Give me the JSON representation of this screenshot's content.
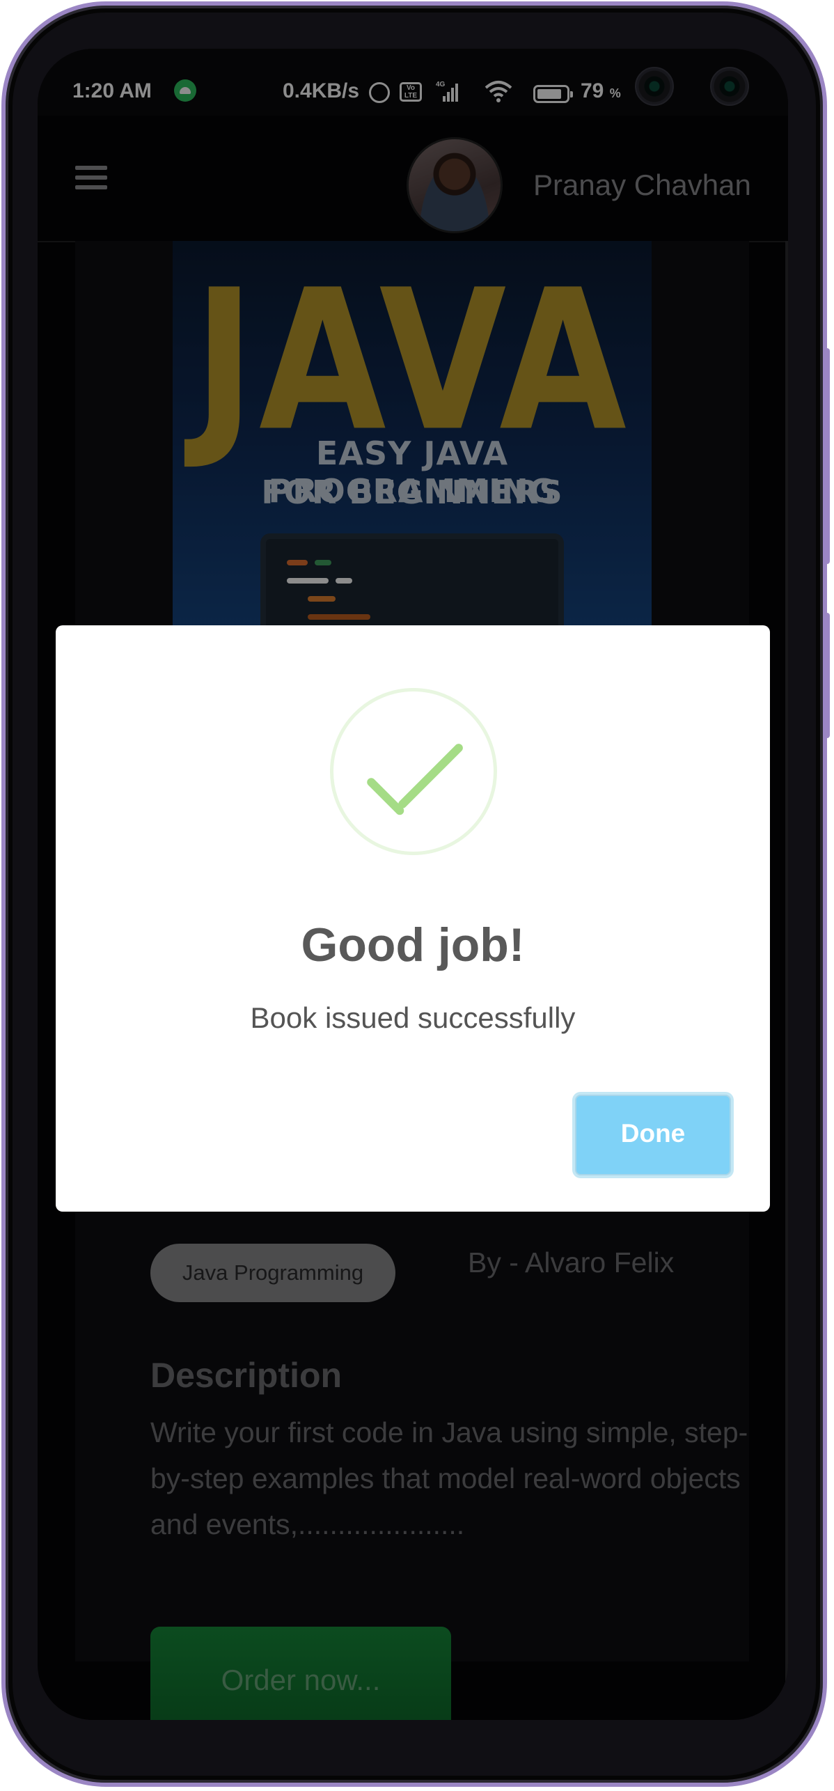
{
  "status_bar": {
    "time": "1:20 AM",
    "network_speed": "0.4KB/s",
    "network_type": "4G",
    "volte": "Vo LTE",
    "battery_level": "79",
    "battery_unit": "%"
  },
  "header": {
    "user_name": "Pranay Chavhan"
  },
  "book": {
    "cover_title": "JAVA",
    "cover_subtitle_line1": "EASY JAVA PROGRAMMING",
    "cover_subtitle_line2": "FOR BEGINNERS",
    "category_tag": "Java Programming",
    "author": "By - Alvaro Felix",
    "description_heading": "Description",
    "description": "Write your first code in Java using simple, step-by-step examples that model real-word objects and events,.....................",
    "order_button": "Order now..."
  },
  "dialog": {
    "icon": "success-check-icon",
    "title": "Good job!",
    "message": "Book issued successfully",
    "confirm_button": "Done",
    "confirm_color": "#7fd2f7",
    "check_color": "#a5dc86"
  },
  "colors": {
    "phone_frame": "#9b86c4",
    "order_button": "#168a3a",
    "screen_bg": "#050506"
  }
}
